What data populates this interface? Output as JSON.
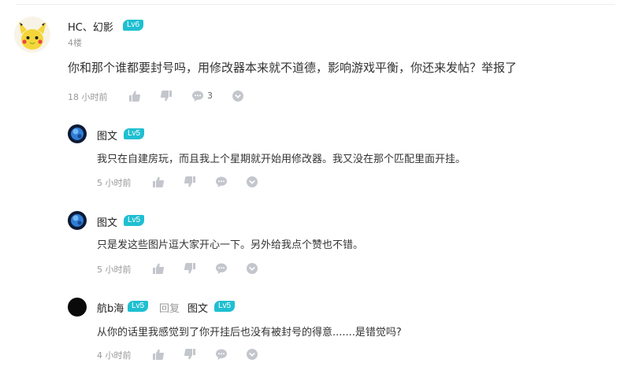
{
  "colors": {
    "level_badge": "#1fbfd1",
    "muted": "#999999",
    "icon": "#c3c6cc"
  },
  "main_comment": {
    "author": "HC、幻影",
    "level": "Lv6",
    "floor": "4楼",
    "text": "你和那个谁都要封号吗，用修改器本来就不道德，影响游戏平衡，你还来发帖？举报了",
    "time": "18 小时前",
    "reply_count": "3"
  },
  "replies": [
    {
      "author": "图文",
      "level": "Lv5",
      "text": "我只在自建房玩，而且我上个星期就开始用修改器。我又没在那个匹配里面开挂。",
      "time": "5 小时前"
    },
    {
      "author": "图文",
      "level": "Lv5",
      "text": "只是发这些图片逗大家开心一下。另外给我点个赞也不错。",
      "time": "5 小时前"
    },
    {
      "author": "航b海",
      "level": "Lv5",
      "reply_word": "回复",
      "reply_to": "图文",
      "reply_to_level": "Lv5",
      "text": "从你的话里我感觉到了你开挂后也没有被封号的得意.......是错觉吗?",
      "time": "4 小时前"
    }
  ]
}
